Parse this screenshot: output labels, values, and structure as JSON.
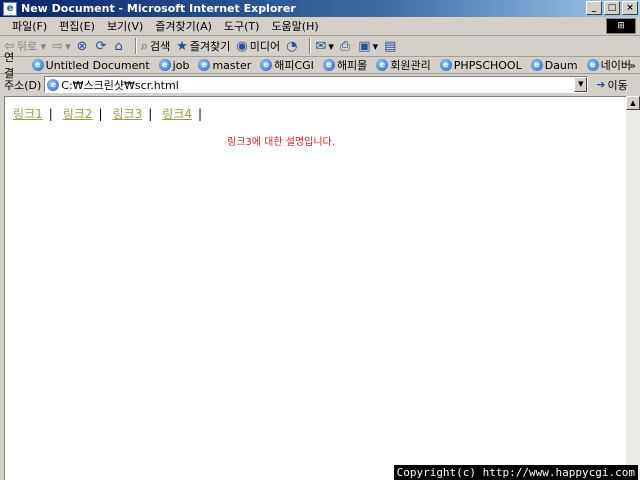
{
  "window": {
    "title": "New Document - Microsoft Internet Explorer",
    "buttons": [
      "_",
      "□",
      "×"
    ]
  },
  "menu": {
    "items": [
      "파일(F)",
      "편집(E)",
      "보기(V)",
      "즐겨찾기(A)",
      "도구(T)",
      "도움말(H)"
    ]
  },
  "toolbar": {
    "back": "뒤로",
    "search": "검색",
    "favorites": "즐겨찾기",
    "media": "미디어"
  },
  "links": {
    "label": "연결",
    "items": [
      "Untitled Document",
      "job",
      "master",
      "해피CGI",
      "해피몰",
      "회원관리",
      "PHPSCHOOL",
      "Daum",
      "네이버"
    ],
    "more": "»"
  },
  "address": {
    "label": "주소(D)",
    "value": "C:₩스크린샷₩scr.html",
    "go": "이동"
  },
  "page": {
    "links": [
      "링크1",
      "링크2",
      "링크3",
      "링크4"
    ],
    "separator": "|",
    "description": "링크3에 대한 설명입니다."
  },
  "footer": {
    "copyright": "Copyright(c) http://www.happycgi.com"
  }
}
